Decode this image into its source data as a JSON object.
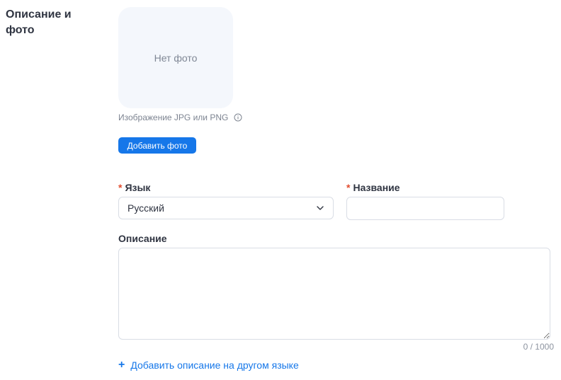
{
  "section": {
    "title": "Описание и фото"
  },
  "photo": {
    "placeholder": "Нет фото",
    "hint": "Изображение JPG или PNG",
    "info_icon": "info-circle-icon",
    "add_button_label": "Добавить фото"
  },
  "language_field": {
    "required_mark": "*",
    "label": "Язык",
    "value": "Русский",
    "chevron_icon": "chevron-down-icon"
  },
  "name_field": {
    "required_mark": "*",
    "label": "Название",
    "value": ""
  },
  "description_field": {
    "label": "Описание",
    "value": "",
    "counter": "0 / 1000"
  },
  "add_description": {
    "icon": "+",
    "label": "Добавить описание на другом языке"
  },
  "colors": {
    "accent": "#1677e9",
    "required": "#e24d2f",
    "photo_bg": "#f4f7fc",
    "border": "#d9dde5",
    "text": "#2f3441",
    "muted": "#7d8491"
  }
}
